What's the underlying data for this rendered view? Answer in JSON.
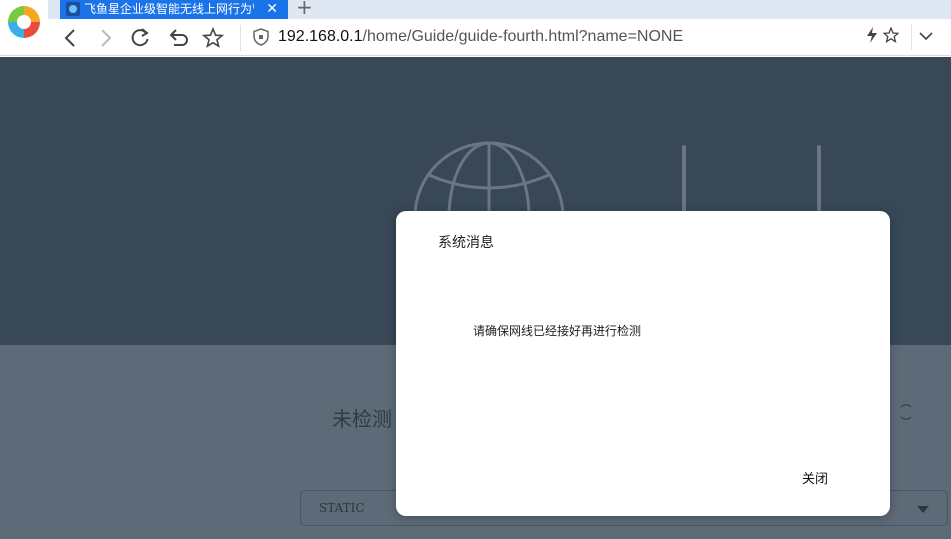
{
  "browser": {
    "tab": {
      "title": "飞鱼星企业级智能无线上网行为管理"
    },
    "url": {
      "host": "192.168.0.1",
      "path": "/home/Guide/guide-fourth.html?name=NONE"
    }
  },
  "page": {
    "status_text": "未检测",
    "connection_type": "STATIC"
  },
  "dialog": {
    "title": "系统消息",
    "message": "请确保网线已经接好再进行检测",
    "close_label": "关闭"
  },
  "colors": {
    "tab_active": "#1a73e8",
    "hero_bg": "#384857",
    "lower_bg": "#5d6a77",
    "dialog_bg": "#ffffff"
  }
}
